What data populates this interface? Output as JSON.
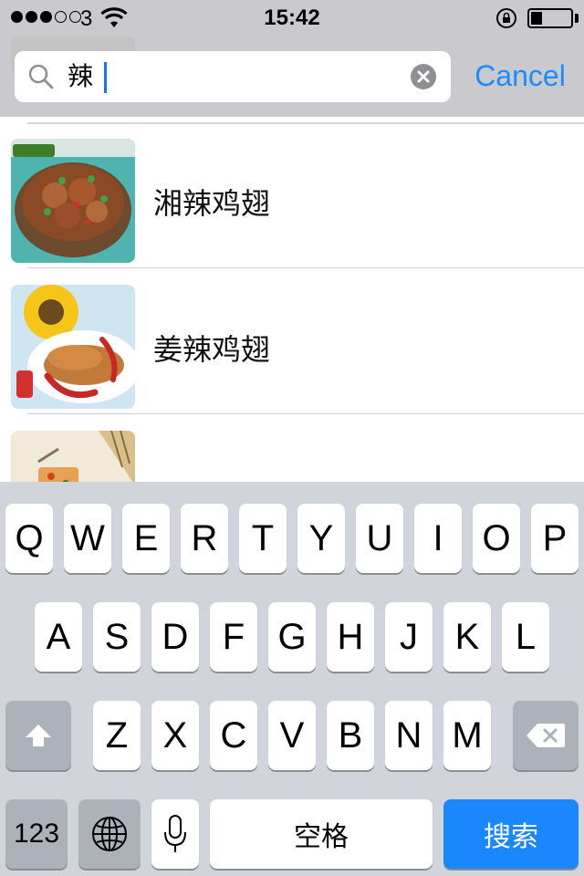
{
  "status_bar": {
    "carrier": "3",
    "time": "15:42",
    "signal_filled": 3,
    "signal_empty": 2,
    "battery_level": 0.28
  },
  "search": {
    "value": "辣",
    "cancel_label": "Cancel"
  },
  "results": [
    {
      "title": "湘辣鸡翅",
      "image": "dish-photo"
    },
    {
      "title": "姜辣鸡翅",
      "image": "dish-photo"
    },
    {
      "title": "",
      "image": "dish-photo"
    }
  ],
  "keyboard": {
    "row1": [
      "Q",
      "W",
      "E",
      "R",
      "T",
      "Y",
      "U",
      "I",
      "O",
      "P"
    ],
    "row2": [
      "A",
      "S",
      "D",
      "F",
      "G",
      "H",
      "J",
      "K",
      "L"
    ],
    "row3": [
      "Z",
      "X",
      "C",
      "V",
      "B",
      "N",
      "M"
    ],
    "numbers_label": "123",
    "space_label": "空格",
    "return_label": "搜索"
  },
  "colors": {
    "accent": "#1a87ff",
    "bar_bg": "#c9c9ce",
    "keyboard_bg": "#d1d4db"
  }
}
